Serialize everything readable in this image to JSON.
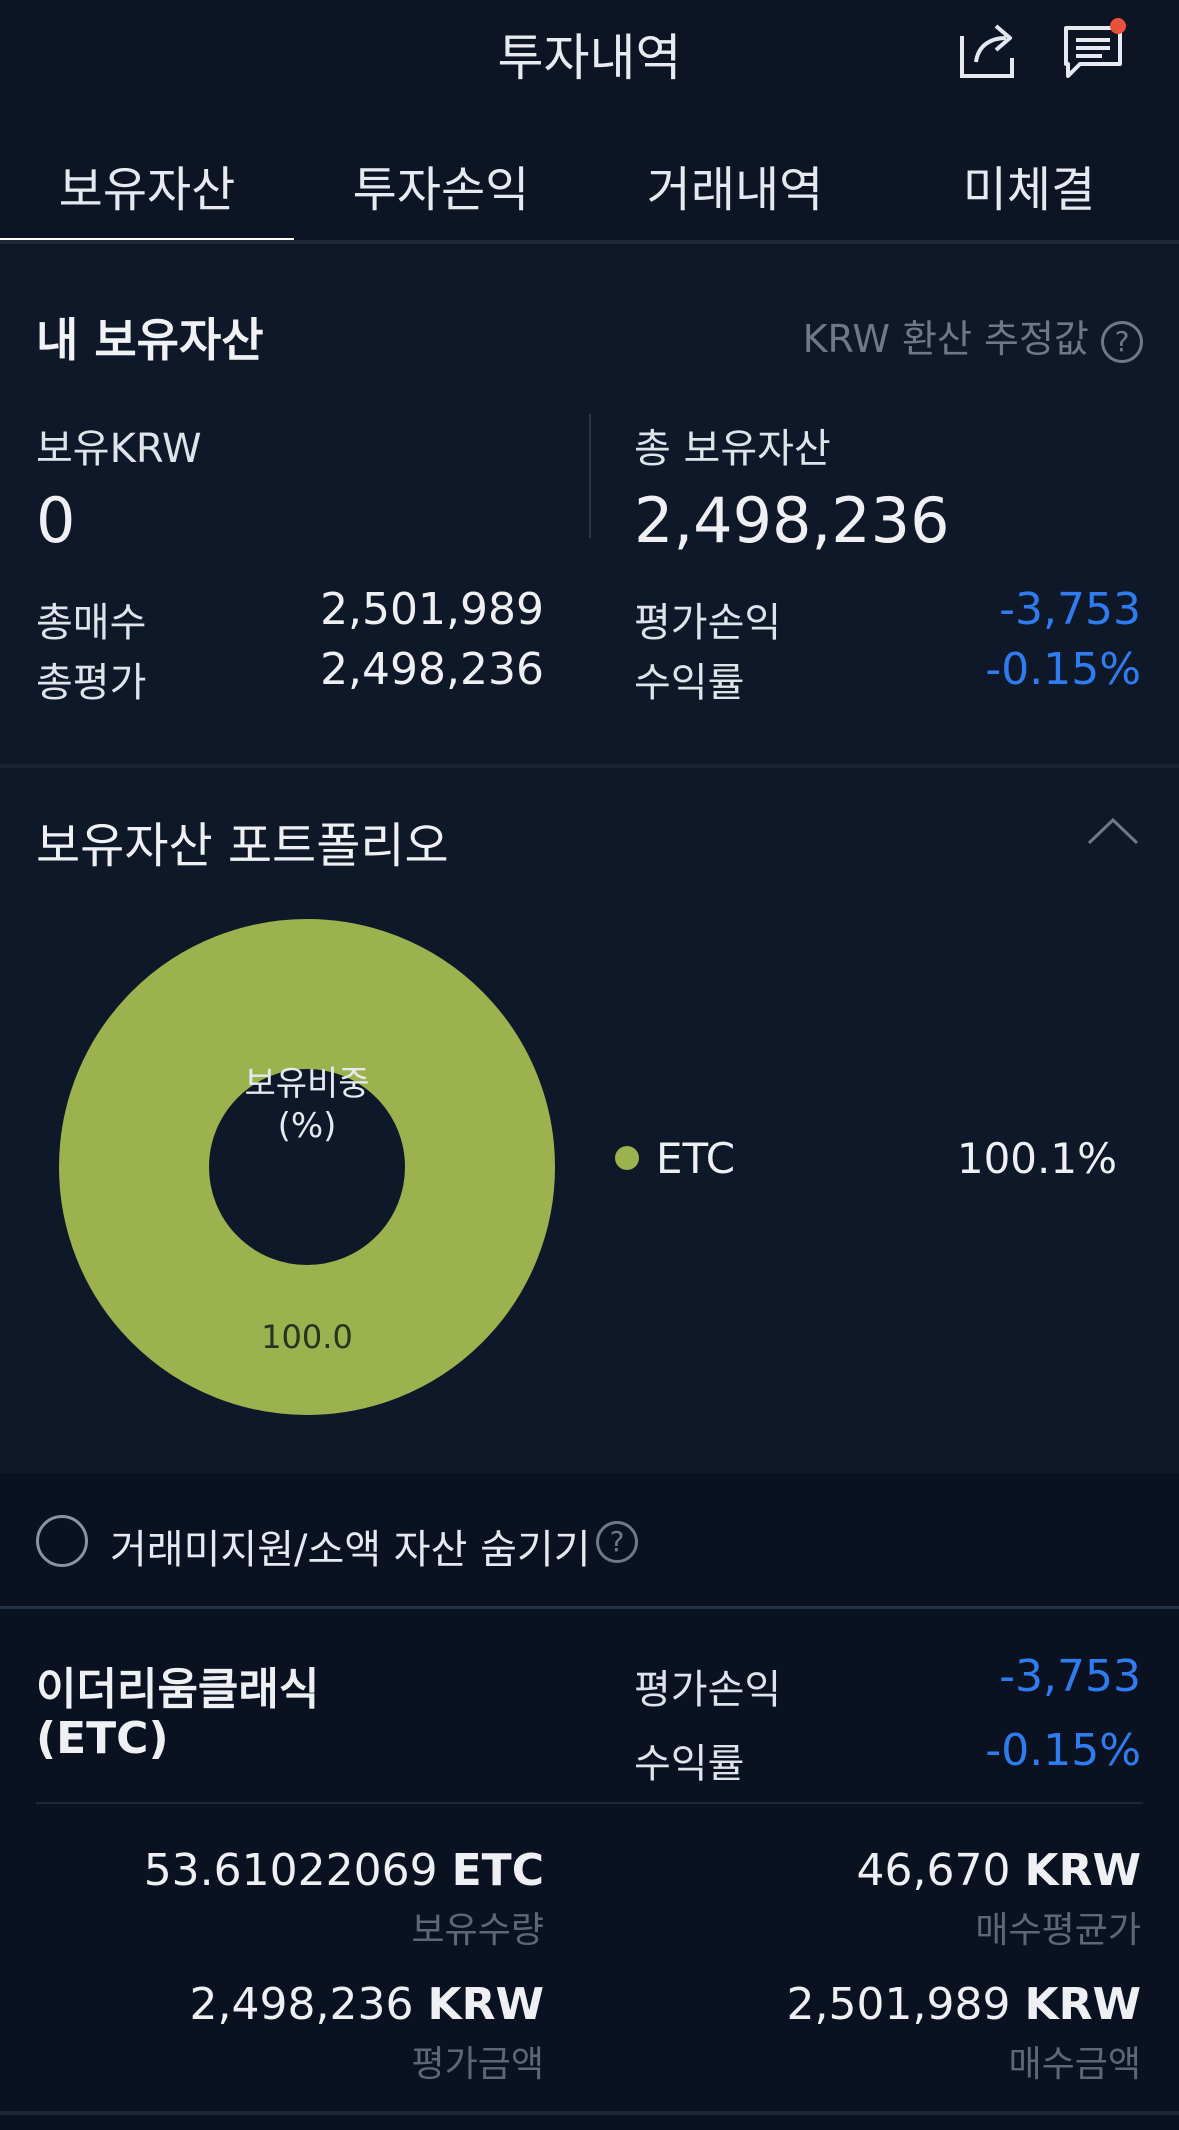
{
  "header": {
    "title": "투자내역",
    "share_icon": "share-icon",
    "message_icon": "message-list-icon",
    "notification_dot_color": "#e8513a"
  },
  "tabs": [
    {
      "label": "보유자산",
      "active": true
    },
    {
      "label": "투자손익",
      "active": false
    },
    {
      "label": "거래내역",
      "active": false
    },
    {
      "label": "미체결",
      "active": false
    }
  ],
  "summary": {
    "title": "내 보유자산",
    "note": "KRW 환산 추정값",
    "krw_label": "보유KRW",
    "krw_value": "0",
    "total_label": "총 보유자산",
    "total_value": "2,498,236",
    "total_buy_label": "총매수",
    "total_buy_value": "2,501,989",
    "total_eval_label": "총평가",
    "total_eval_value": "2,498,236",
    "pnl_label": "평가손익",
    "pnl_value": "-3,753",
    "rate_label": "수익률",
    "rate_value": "-0.15%"
  },
  "portfolio": {
    "title": "보유자산 포트폴리오",
    "chart_center_line1": "보유비중",
    "chart_center_line2": "(%)",
    "chart_data": {
      "type": "pie",
      "categories": [
        "ETC"
      ],
      "values": [
        100.0
      ],
      "slice_labels": [
        "100.0"
      ],
      "colors": [
        "#9bb24f"
      ]
    },
    "legend": [
      {
        "name": "ETC",
        "percent": "100.1%",
        "color": "#9bb24f"
      }
    ]
  },
  "hide_option": {
    "label": "거래미지원/소액 자산 숨기기"
  },
  "asset": {
    "name_line1": "이더리움클래식",
    "name_line2": "(ETC)",
    "pnl_label": "평가손익",
    "pnl_value": "-3,753",
    "rate_label": "수익률",
    "rate_value": "-0.15%",
    "quantity_value": "53.61022069",
    "quantity_unit": "ETC",
    "quantity_label": "보유수량",
    "avg_price_value": "46,670",
    "avg_price_unit": "KRW",
    "avg_price_label": "매수평균가",
    "eval_amount_value": "2,498,236",
    "eval_amount_unit": "KRW",
    "eval_amount_label": "평가금액",
    "buy_amount_value": "2,501,989",
    "buy_amount_unit": "KRW",
    "buy_amount_label": "매수금액"
  }
}
